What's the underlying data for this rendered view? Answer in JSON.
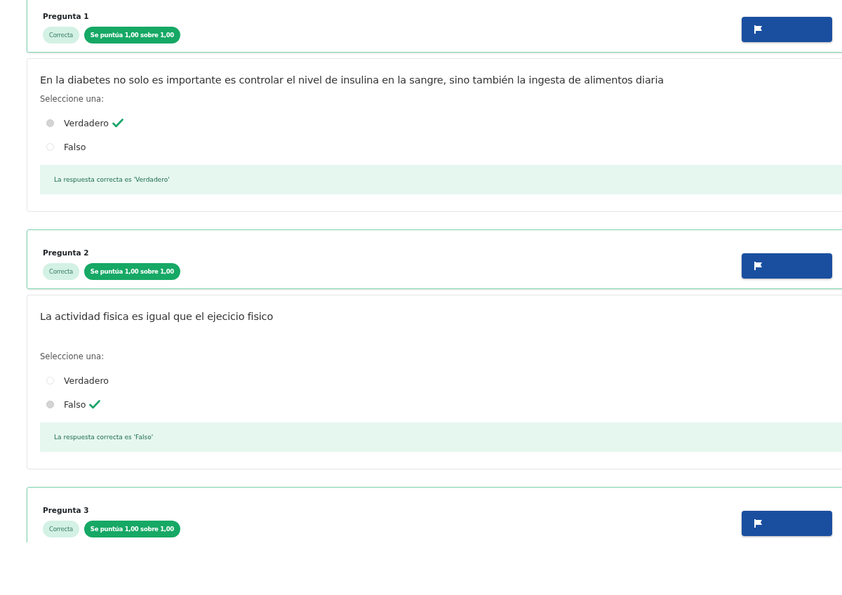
{
  "questions": [
    {
      "label": "Pregunta 1",
      "status": "Correcta",
      "score": "Se puntúa 1,00 sobre 1,00",
      "text": "En la diabetes no solo es importante es controlar el nivel de insulina en la sangre, sino también la ingesta de alimentos diaria",
      "prompt": "Seleccione una:",
      "options": [
        {
          "label": "Verdadero",
          "selected": true,
          "correct": true
        },
        {
          "label": "Falso",
          "selected": false,
          "correct": false
        }
      ],
      "feedback": "La respuesta correcta es 'Verdadero'"
    },
    {
      "label": "Pregunta 2",
      "status": "Correcta",
      "score": "Se puntúa 1,00 sobre 1,00",
      "text": "La actividad fisica es igual que el ejecicio fisico",
      "prompt": "Seleccione una:",
      "options": [
        {
          "label": "Verdadero",
          "selected": false,
          "correct": false
        },
        {
          "label": "Falso",
          "selected": true,
          "correct": true
        }
      ],
      "feedback": "La respuesta correcta es 'Falso'"
    },
    {
      "label": "Pregunta 3",
      "status": "Correcta",
      "score": "Se puntúa 1,00 sobre 1,00"
    }
  ]
}
